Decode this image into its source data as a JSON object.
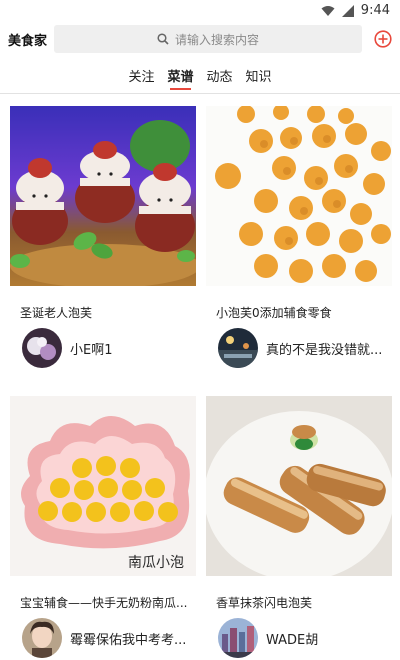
{
  "status_bar": {
    "time": "9:44"
  },
  "header": {
    "title": "美食家",
    "search_placeholder": "请输入搜索内容"
  },
  "tabs": [
    {
      "label": "关注",
      "active": false
    },
    {
      "label": "菜谱",
      "active": true
    },
    {
      "label": "动态",
      "active": false
    },
    {
      "label": "知识",
      "active": false
    }
  ],
  "accent_color": "#e8483c",
  "cards": [
    {
      "caption": "圣诞老人泡芙",
      "author": "小E啊1"
    },
    {
      "caption": "小泡芙0添加辅食零食",
      "author": "真的不是我没错就..."
    },
    {
      "caption": "宝宝辅食——快手无奶粉南瓜...",
      "author": "霉霉保佑我中考考...",
      "photo_text": "南瓜小泡"
    },
    {
      "caption": "香草抹茶闪电泡芙",
      "author": "WADE胡"
    }
  ]
}
